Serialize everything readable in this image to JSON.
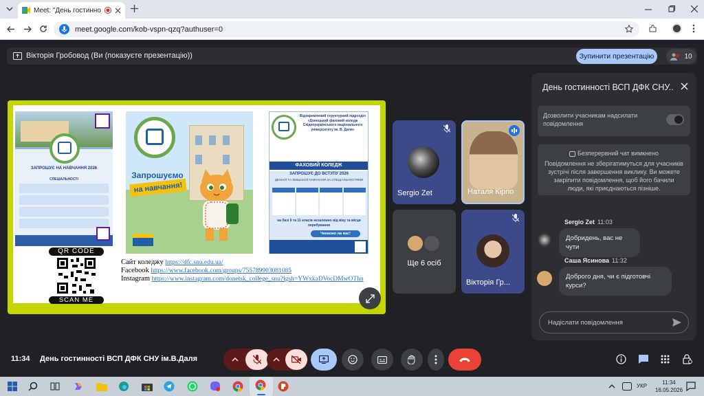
{
  "browser": {
    "tab_title": "Meet: \"День гостинності В",
    "url": "meet.google.com/kob-vspn-qzq?authuser=0"
  },
  "presentation_bar": {
    "label": "Вікторія Гробовод (Ви (показуєте презентацію))",
    "stop_button": "Зупинити презентацію",
    "participants_count": "10"
  },
  "slide": {
    "qr_code_label": "QR CODE",
    "scan_me_label": "SCAN ME",
    "invite_line1": "Запрошуємо",
    "invite_line2": "на навчання!",
    "left_poster": {
      "title": "ЗАПРОШУЄ НА НАВЧАННЯ 2026",
      "subtitle": "СПЕЦІАЛЬНОСТІ"
    },
    "right_poster": {
      "header": "Відокремлений структурний підрозділ «Донецький фаховий коледж Східноукраїнського національного університету ім. В. Даля»",
      "title": "ФАХОВИЙ КОЛЕДЖ",
      "invite": "ЗАПРОШУЄ ДО ВСТУПУ 2026",
      "forms": "ДЕННОЇ ТА ЗМІШАНОЇ НАВЧАННЯ ЗА СПЕЦІАЛЬНОСТЯМИ",
      "basis": "на базі 9 та 11 класів незалежно від віку та місця перебування",
      "waiting": "Чекаємо на вас!"
    },
    "links": {
      "site_label": "Сайт коледжу",
      "site_url": "https://dfc.snu.edu.ua/",
      "fb_label": "Facebook",
      "fb_url": "https://www.facebook.com/groups/755789903081085",
      "ig_label": "Instagram",
      "ig_url": "https://www.instagram.com/donetsk_college_snu?igsh=YWxkaDVocDMwOThn"
    }
  },
  "tiles": [
    {
      "name": "Sergio Zet"
    },
    {
      "name": "Наталя Кірпо"
    },
    {
      "name": "Ще 6 осіб"
    },
    {
      "name": "Вікторія Гр..."
    }
  ],
  "chat": {
    "title": "День гостинності ВСП ДФК СНУ...",
    "allow_label": "Дозволити учасникам надсилати повідомлення",
    "info_heading": "Безперервний чат вимкнено",
    "info_body": "Повідомлення не зберігатимуться для учасників зустрічі після завершення виклику. Ви можете закріпити повідомлення, щоб його бачили люди, які приєднаються пізніше.",
    "messages": [
      {
        "author": "Sergio Zet",
        "time": "11:03",
        "text": "Добридень, вас не чути"
      },
      {
        "author": "Саша Ясинова",
        "time": "11:32",
        "text": "Доброго дня, чи є підготовчі курси?"
      }
    ],
    "input_placeholder": "Надіслати повідомлення"
  },
  "footer": {
    "time": "11:34",
    "meeting_name": "День гостинності ВСП ДФК СНУ ім.В.Даля"
  },
  "taskbar": {
    "lang": "УКР",
    "time": "11:34",
    "date": "16.05.2026"
  },
  "colors": {
    "accent": "#a8c7fa",
    "end_call": "#ea4335",
    "muted": "#f9dedc",
    "slide_border": "#c4d600"
  }
}
